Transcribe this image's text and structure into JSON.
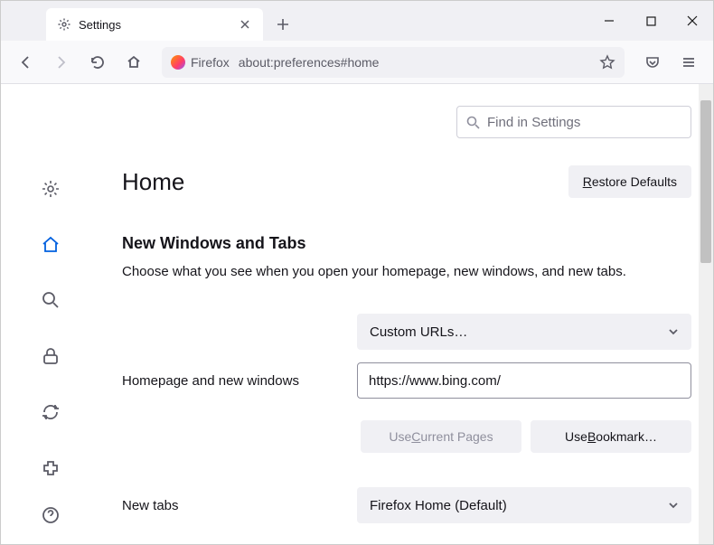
{
  "tab": {
    "title": "Settings"
  },
  "urlbar": {
    "brand": "Firefox",
    "url": "about:preferences#home"
  },
  "search": {
    "placeholder": "Find in Settings"
  },
  "page": {
    "title": "Home",
    "restore_btn": "Restore Defaults"
  },
  "section": {
    "heading": "New Windows and Tabs",
    "desc": "Choose what you see when you open your homepage, new windows, and new tabs."
  },
  "homepage": {
    "label": "Homepage and new windows",
    "select_value": "Custom URLs…",
    "url_value": "https://www.bing.com/",
    "use_current": "Use Current Pages",
    "use_bookmark": "Use Bookmark…"
  },
  "newtabs": {
    "label": "New tabs",
    "select_value": "Firefox Home (Default)"
  },
  "underline": {
    "restore_R": "R",
    "restore_rest": "estore Defaults",
    "current_C": "C",
    "current_pre": "Use ",
    "current_post": "urrent Pages",
    "bookmark_B": "B",
    "bookmark_pre": "Use ",
    "bookmark_post": "ookmark…"
  }
}
